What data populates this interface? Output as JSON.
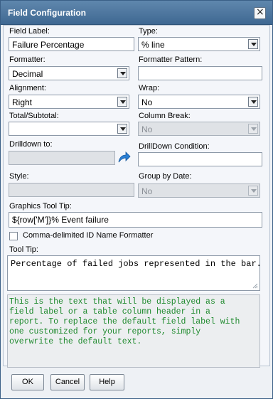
{
  "dialog": {
    "title": "Field Configuration",
    "close_glyph": "×"
  },
  "field_label": {
    "label": "Field Label:",
    "value": "Failure Percentage"
  },
  "type": {
    "label": "Type:",
    "value": "% line"
  },
  "formatter": {
    "label": "Formatter:",
    "value": "Decimal"
  },
  "formatter_pattern": {
    "label": "Formatter Pattern:",
    "value": ""
  },
  "alignment": {
    "label": "Alignment:",
    "value": "Right"
  },
  "wrap": {
    "label": "Wrap:",
    "value": "No"
  },
  "total_subtotal": {
    "label": "Total/Subtotal:",
    "value": ""
  },
  "column_break": {
    "label": "Column Break:",
    "value": "No"
  },
  "drilldown_to": {
    "label": "Drilldown to:",
    "value": ""
  },
  "drilldown_condition": {
    "label": "DrillDown Condition:",
    "value": ""
  },
  "style": {
    "label": "Style:",
    "value": ""
  },
  "group_by_date": {
    "label": "Group by Date:",
    "value": "No"
  },
  "graphics_tooltip": {
    "label": "Graphics Tool Tip:",
    "value": "${row['M']}% Event failure"
  },
  "comma_formatter": {
    "label": "Comma-delimited ID Name Formatter",
    "checked": false
  },
  "tooltip": {
    "label": "Tool Tip:",
    "value": "Percentage of failed jobs represented in the bar."
  },
  "help_text": [
    "This is the text that will be displayed as a",
    "field label or a table column header in a",
    "report. To replace the default field label with",
    "one customized for your reports, simply",
    "overwrite the default text."
  ],
  "buttons": {
    "ok": "OK",
    "cancel": "Cancel",
    "help": "Help"
  },
  "colors": {
    "title_bar": "#4a7299",
    "help_text": "#1f8a2e",
    "drill_icon": "#2a7fd4"
  }
}
